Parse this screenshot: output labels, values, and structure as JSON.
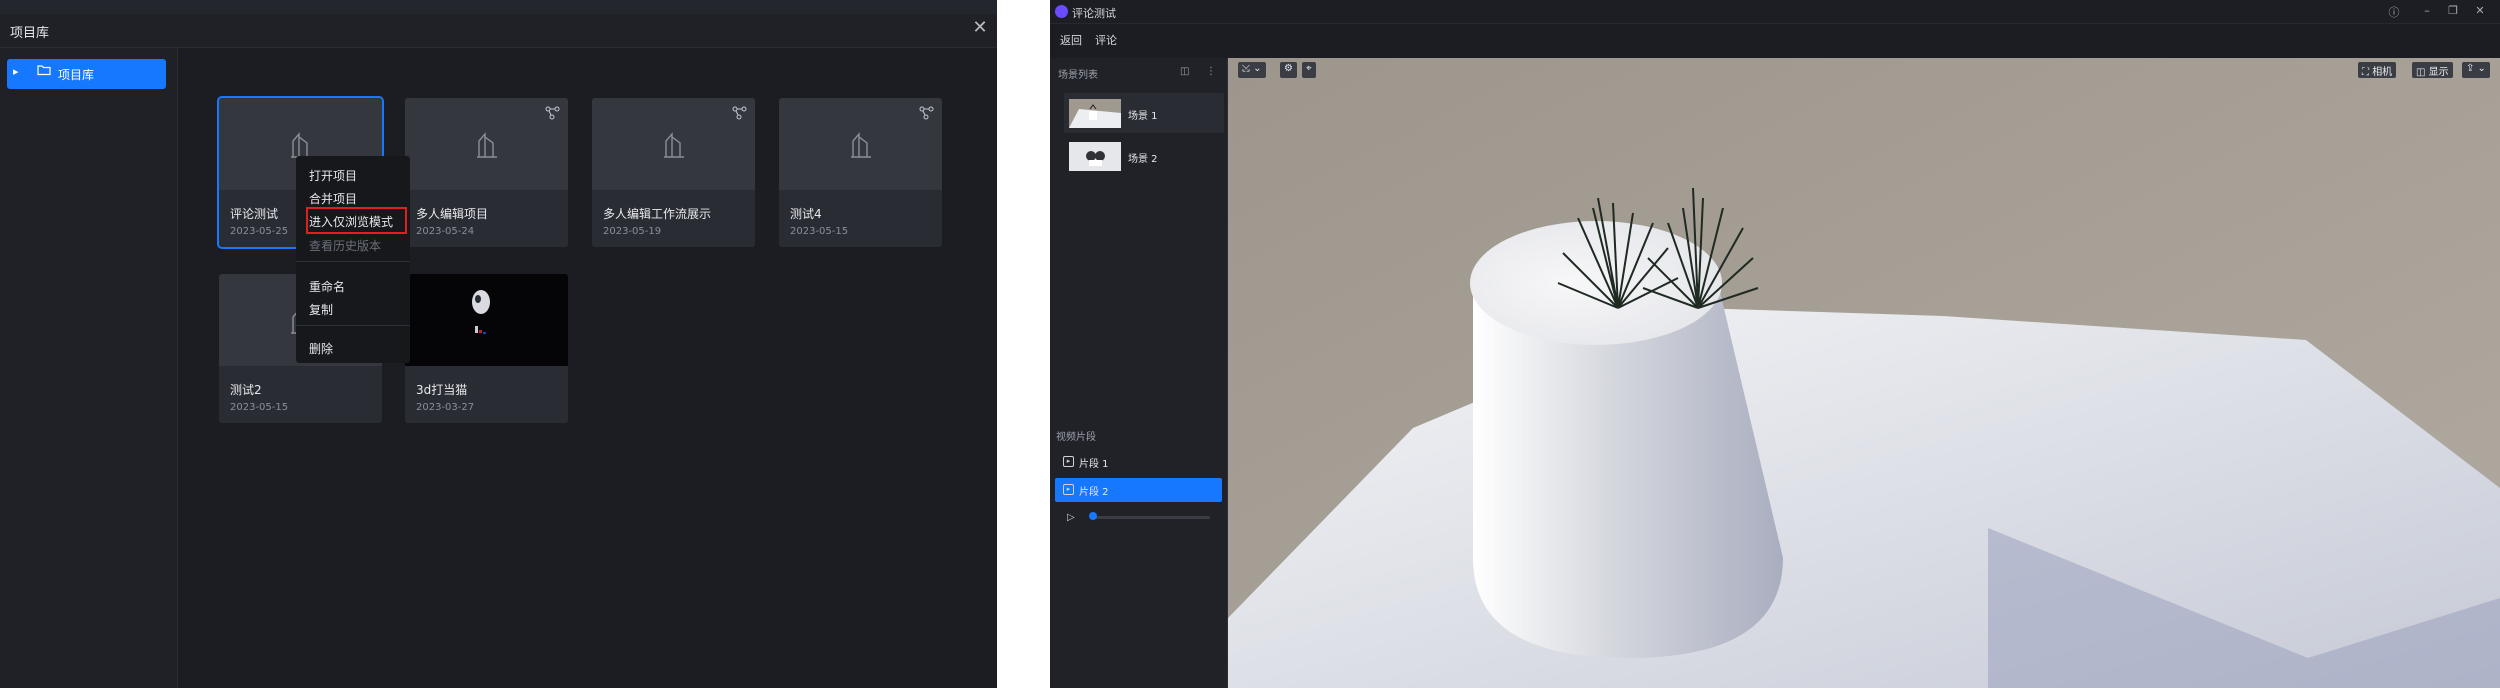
{
  "left_window": {
    "title": "项目库",
    "close_icon": "close-icon",
    "sidebar": {
      "root_label": "项目库",
      "caret_icon": "caret-right-icon",
      "folder_icon": "folder-icon"
    },
    "projects": [
      {
        "name": "评论测试",
        "date": "2023-05-25",
        "selected": true,
        "thumb": "placeholder"
      },
      {
        "name": "多人编辑项目",
        "date": "2023-05-24",
        "thumb": "placeholder",
        "corner_icon": "collab-icon"
      },
      {
        "name": "多人编辑工作流展示",
        "date": "2023-05-19",
        "thumb": "placeholder",
        "corner_icon": "collab-icon"
      },
      {
        "name": "测试4",
        "date": "2023-05-15",
        "thumb": "placeholder",
        "corner_icon": "collab-icon"
      },
      {
        "name": "测试2",
        "date": "2023-05-15",
        "thumb": "placeholder"
      },
      {
        "name": "3d打当猫",
        "date": "2023-03-27",
        "thumb": "dark-render"
      }
    ],
    "context_menu": {
      "items": [
        {
          "label": "打开项目"
        },
        {
          "label": "合并项目"
        },
        {
          "label": "进入仅浏览模式",
          "highlighted": true
        },
        {
          "label": "查看历史版本",
          "disabled": true
        },
        {
          "label": "重命名"
        },
        {
          "label": "复制"
        },
        {
          "label": "删除"
        }
      ],
      "highlight_color": "#e02020"
    }
  },
  "right_window": {
    "title": "评论测试",
    "window_controls": [
      "help-icon",
      "minimize-icon",
      "maximize-icon",
      "close-icon"
    ],
    "menu": [
      "返回",
      "评论"
    ],
    "scene_list": {
      "header": "场景列表",
      "items": [
        "场景 1",
        "场景 2"
      ]
    },
    "clips": {
      "header": "视频片段",
      "items": [
        "片段 1",
        "片段 2"
      ],
      "active_index": 1
    },
    "viewport_toolbar": {
      "right": [
        "相机",
        "显示"
      ]
    }
  },
  "colors": {
    "accent": "#1677ff",
    "bg": "#1b1d23",
    "panel": "#2a2c33"
  }
}
